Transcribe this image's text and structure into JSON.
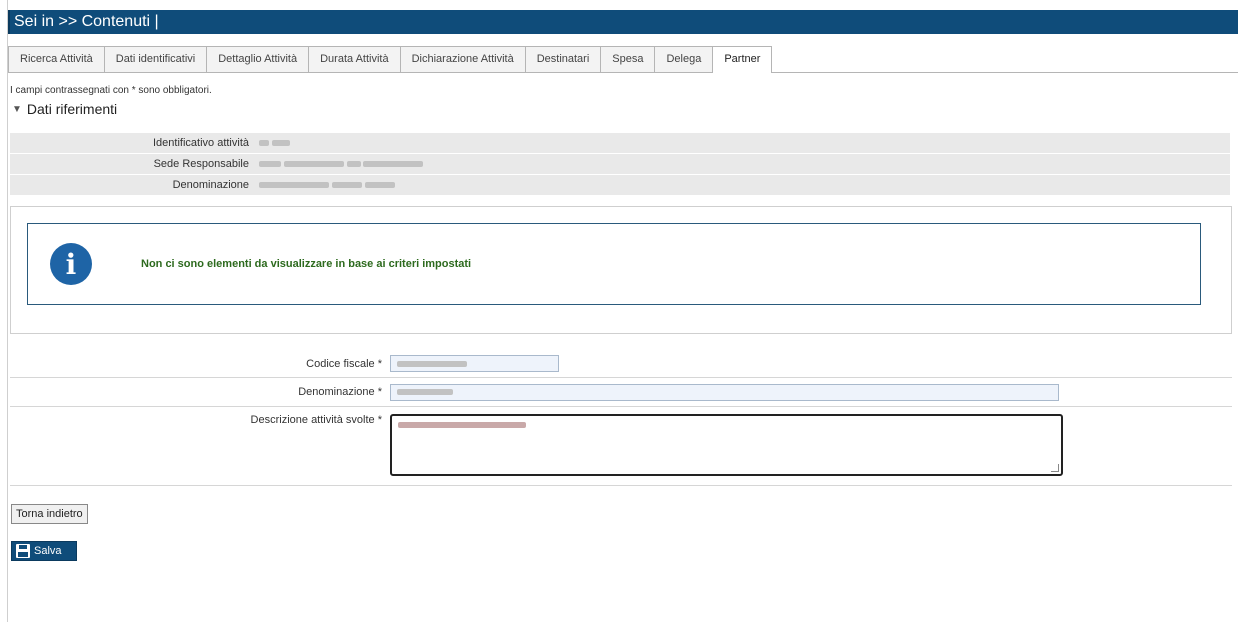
{
  "header": {
    "title": "Sei in >> Contenuti |"
  },
  "tabs": [
    {
      "label": "Ricerca Attività",
      "active": false
    },
    {
      "label": "Dati identificativi",
      "active": false
    },
    {
      "label": "Dettaglio Attività",
      "active": false
    },
    {
      "label": "Durata Attività",
      "active": false
    },
    {
      "label": "Dichiarazione Attività",
      "active": false
    },
    {
      "label": "Destinatari",
      "active": false
    },
    {
      "label": "Spesa",
      "active": false
    },
    {
      "label": "Delega",
      "active": false
    },
    {
      "label": "Partner",
      "active": true
    }
  ],
  "required_note": "I campi contrassegnati con * sono obbligatori.",
  "section": {
    "title": "Dati riferimenti",
    "expanded": true
  },
  "references": [
    {
      "label": "Identificativo attività"
    },
    {
      "label": "Sede Responsabile"
    },
    {
      "label": "Denominazione"
    }
  ],
  "info": {
    "icon": "info-icon",
    "message": "Non ci sono elementi da visualizzare in base ai criteri impostati"
  },
  "form": {
    "codice_fiscale_label": "Codice fiscale *",
    "denominazione_label": "Denominazione *",
    "descrizione_label": "Descrizione attività svolte *"
  },
  "buttons": {
    "back_label": "Torna indietro",
    "save_label": "Salva"
  },
  "colors": {
    "header_bg": "#0f4c7a",
    "info_icon": "#1e64a6",
    "info_text": "#2d6a1e"
  }
}
